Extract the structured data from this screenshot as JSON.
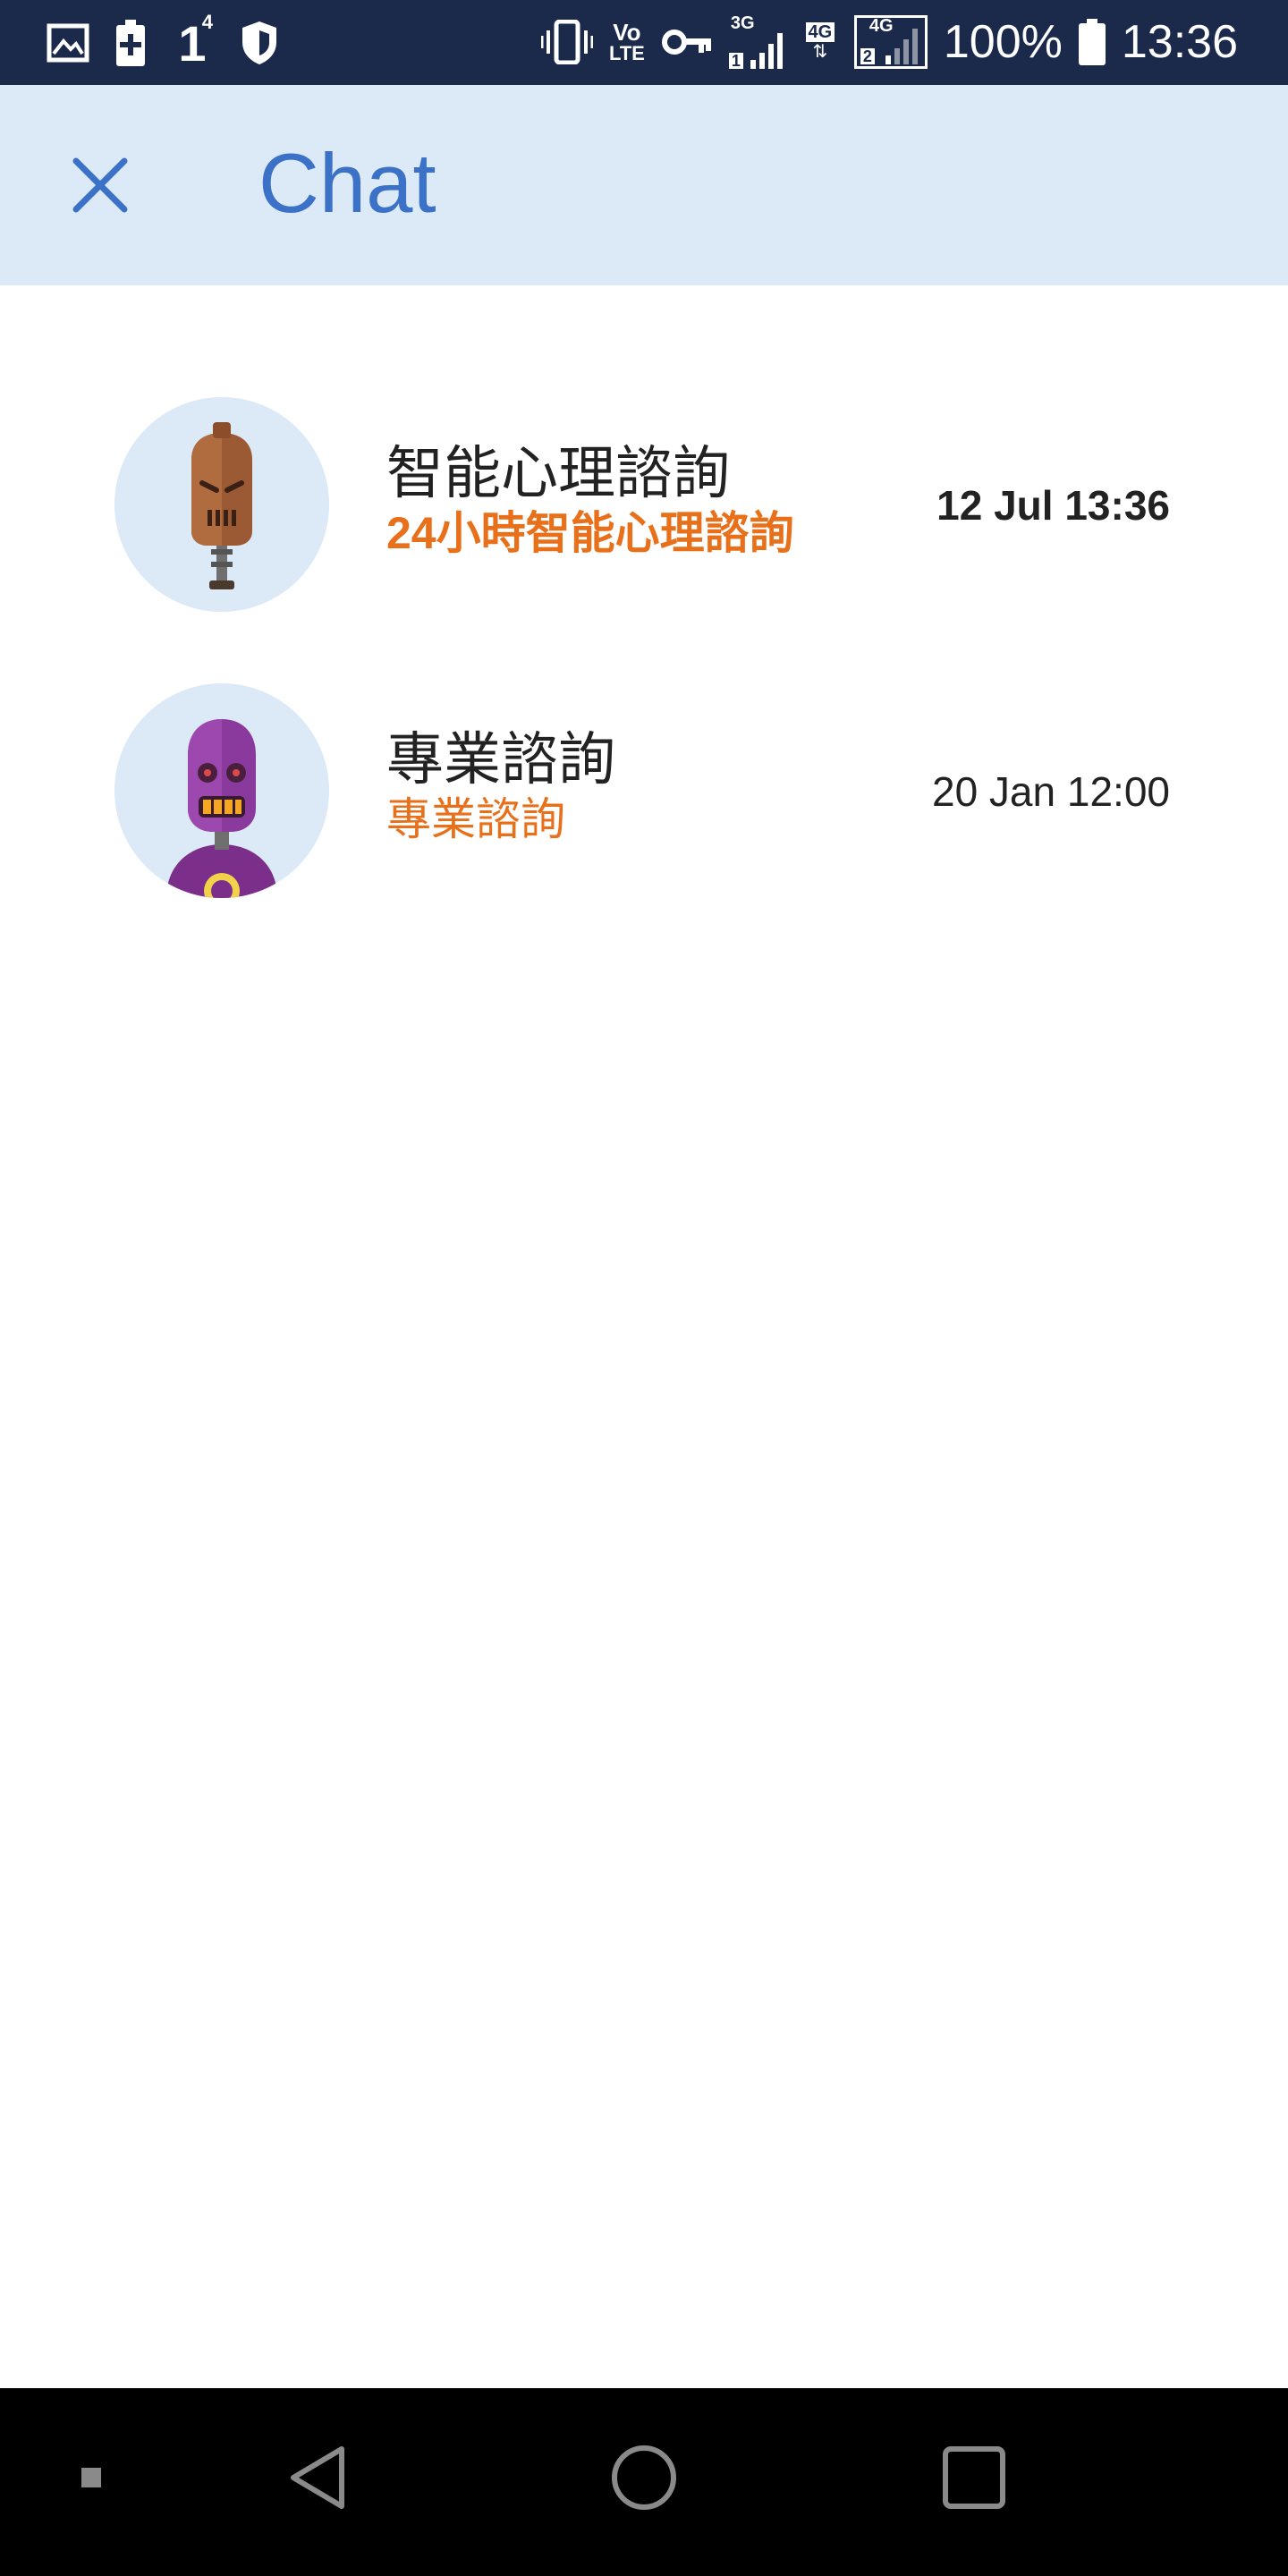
{
  "status_bar": {
    "battery_percent": "100%",
    "time": "13:36",
    "notification_count": "1",
    "notification_superscript": "4",
    "volte_top": "Vo",
    "volte_bottom": "LTE",
    "sim1_network": "3G",
    "sim1_index": "1",
    "sim2_network_a": "4G",
    "sim2_network_b": "4G",
    "sim2_index": "2",
    "icons": [
      "image-icon",
      "battery-saver-icon",
      "shield-icon",
      "vibrate-icon",
      "vpn-key-icon",
      "signal-icon",
      "battery-icon"
    ]
  },
  "app_bar": {
    "title": "Chat",
    "close_icon": "close-icon",
    "accent": "#3b72c8",
    "background": "#dce9f6"
  },
  "chats": [
    {
      "name": "智能心理諮詢",
      "subtitle": "24小時智能心理諮詢",
      "time": "12 Jul 13:36",
      "unread": true,
      "avatar": "brown-robot-avatar"
    },
    {
      "name": "專業諮詢",
      "subtitle": "專業諮詢",
      "time": "20 Jan 12:00",
      "unread": false,
      "avatar": "purple-robot-avatar"
    }
  ],
  "colors": {
    "subtitle": "#e8701a",
    "status_bar": "#1b2a4a",
    "nav_bar": "#000000"
  },
  "nav_bar": {
    "icons": [
      "recent-dot-icon",
      "back-icon",
      "home-icon",
      "overview-icon"
    ]
  }
}
